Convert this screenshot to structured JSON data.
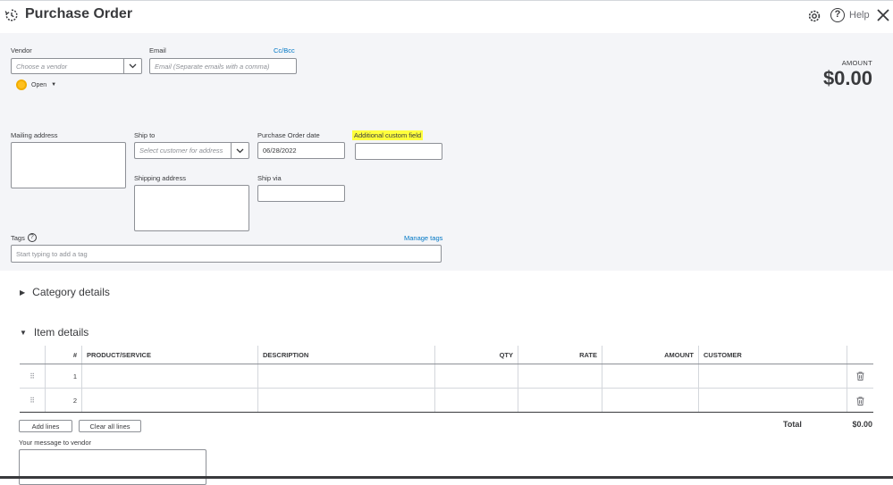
{
  "header": {
    "title": "Purchase Order",
    "help_label": "Help"
  },
  "vendor": {
    "label": "Vendor",
    "placeholder": "Choose a vendor",
    "status": "Open"
  },
  "email": {
    "label": "Email",
    "placeholder": "Email (Separate emails with a comma)",
    "cc_bcc": "Cc/Bcc"
  },
  "amount": {
    "label": "AMOUNT",
    "value": "$0.00"
  },
  "mailing_address": {
    "label": "Mailing address"
  },
  "ship_to": {
    "label": "Ship to",
    "placeholder": "Select customer for address"
  },
  "po_date": {
    "label": "Purchase Order date",
    "value": "06/28/2022"
  },
  "custom_field": {
    "label": "Additional custom field"
  },
  "shipping_address": {
    "label": "Shipping address"
  },
  "ship_via": {
    "label": "Ship via"
  },
  "tags": {
    "label": "Tags",
    "placeholder": "Start typing to add a tag",
    "manage": "Manage tags"
  },
  "category_details": {
    "label": "Category details"
  },
  "item_details": {
    "label": "Item details",
    "columns": [
      "#",
      "PRODUCT/SERVICE",
      "DESCRIPTION",
      "QTY",
      "RATE",
      "AMOUNT",
      "CUSTOMER"
    ],
    "rows": [
      {
        "num": "1"
      },
      {
        "num": "2"
      }
    ]
  },
  "actions": {
    "add_lines": "Add lines",
    "clear_lines": "Clear all lines"
  },
  "totals": {
    "label": "Total",
    "value": "$0.00"
  },
  "message": {
    "label": "Your message to vendor"
  }
}
